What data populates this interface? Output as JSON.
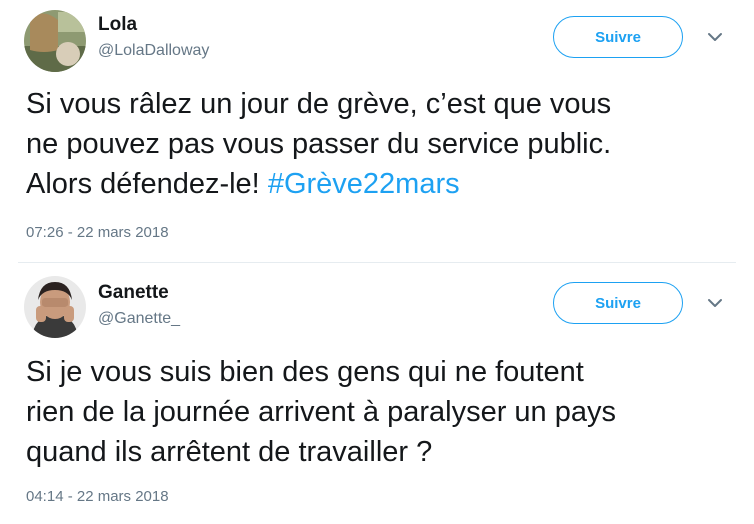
{
  "tweets": [
    {
      "name": "Lola",
      "handle": "@LolaDalloway",
      "follow_label": "Suivre",
      "text": "Si vous râlez un jour de grève, c’est que vous\nne pouvez pas vous passer du service public.\nAlors défendez-le! ",
      "hashtag": "#Grève22mars",
      "timestamp": "07:26 - 22 mars 2018",
      "icons": {
        "menu": "chevron-down-icon",
        "avatar": "avatar"
      },
      "colors": {
        "accent": "#1da1f2",
        "muted": "#657786"
      }
    },
    {
      "name": "Ganette",
      "handle": "@Ganette_",
      "follow_label": "Suivre",
      "text": "Si je vous suis bien des gens qui ne foutent\nrien de la journée arrivent à paralyser un pays\nquand ils arrêtent de travailler ?",
      "timestamp": "04:14 - 22 mars 2018",
      "icons": {
        "menu": "chevron-down-icon",
        "avatar": "avatar"
      },
      "colors": {
        "accent": "#1da1f2",
        "muted": "#657786"
      }
    }
  ]
}
